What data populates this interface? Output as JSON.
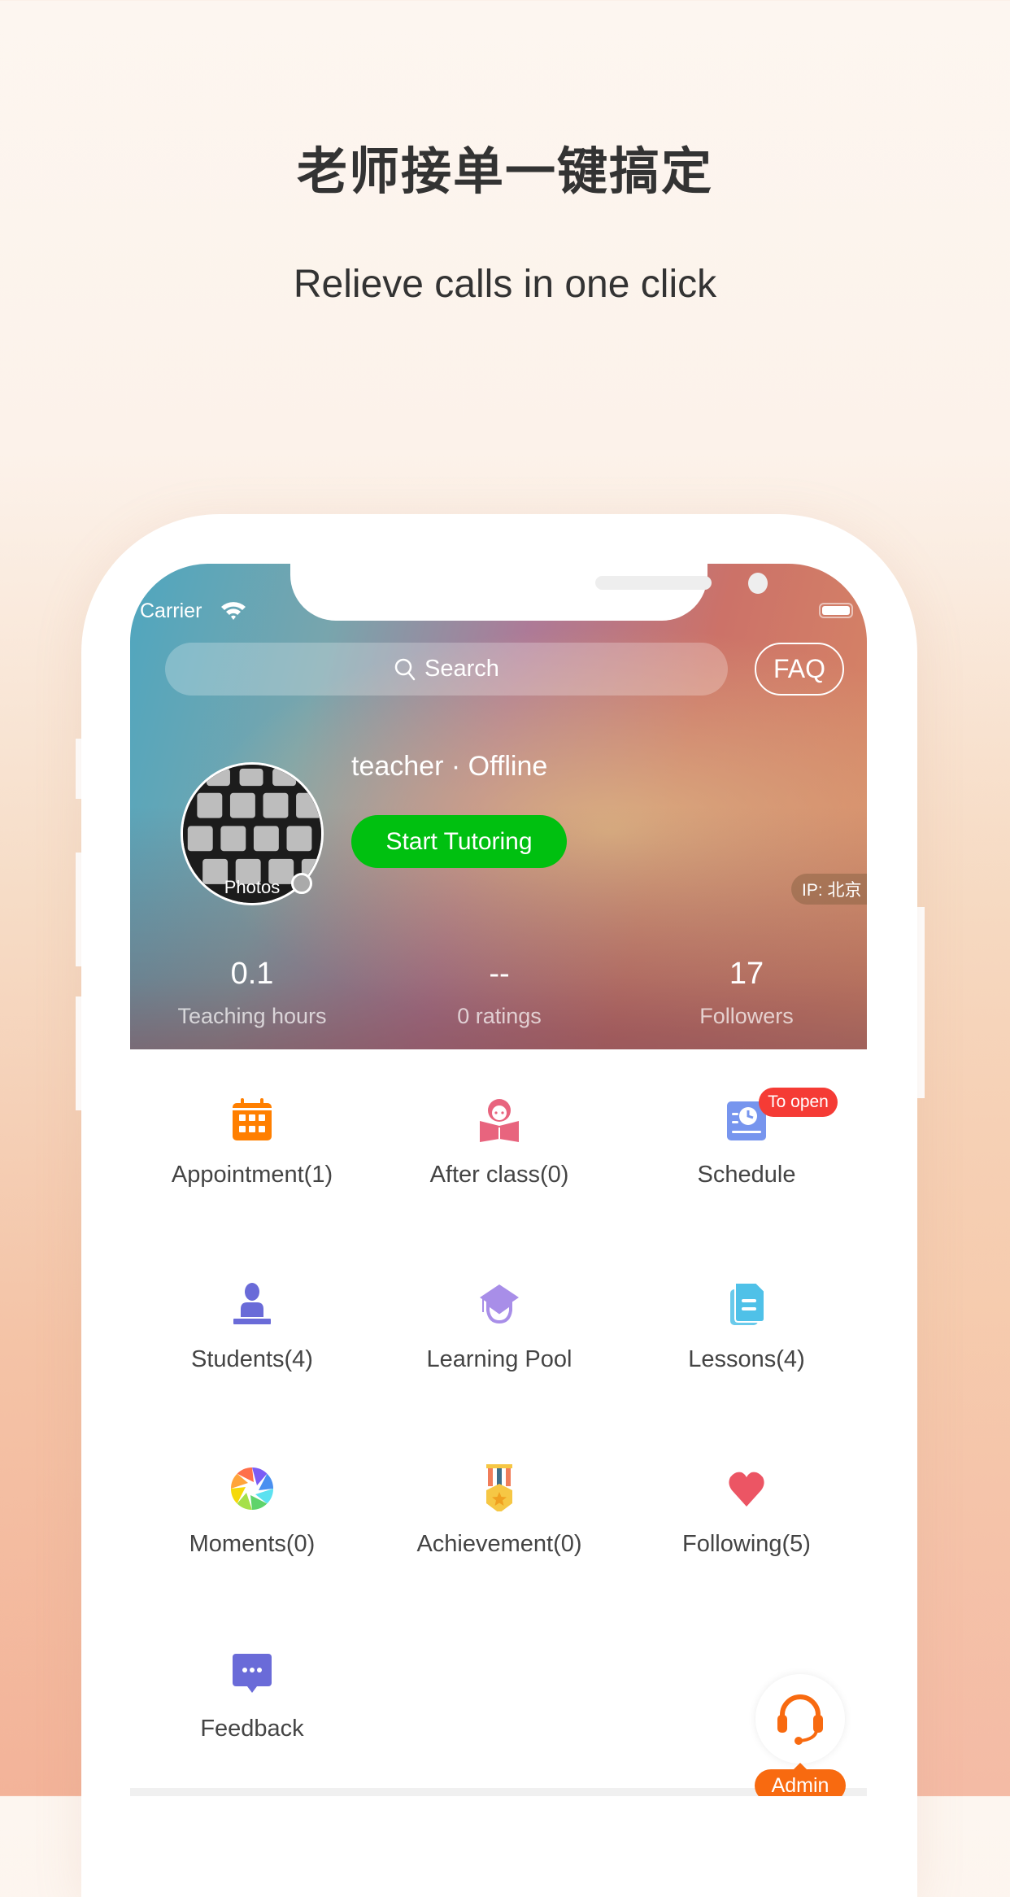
{
  "promo": {
    "title": "老师接单一键搞定",
    "subtitle": "Relieve calls in one click"
  },
  "status_bar": {
    "carrier": "Carrier",
    "wifi_icon": "wifi-icon",
    "battery_icon": "battery-icon"
  },
  "header": {
    "search_placeholder": "Search",
    "search_icon": "search-icon",
    "faq_label": "FAQ",
    "avatar_label": "Photos",
    "name_status": "teacher · Offline",
    "start_button": "Start Tutoring",
    "ip_label": "IP: 北京",
    "stats": [
      {
        "value": "0.1",
        "label": "Teaching hours"
      },
      {
        "value": "--",
        "label": "0 ratings"
      },
      {
        "value": "17",
        "label": "Followers"
      }
    ]
  },
  "menu": {
    "items": [
      {
        "label": "Appointment(1)",
        "icon": "calendar-icon",
        "color": "#ff7f00"
      },
      {
        "label": "After class(0)",
        "icon": "reading-icon",
        "color": "#e8647e"
      },
      {
        "label": "Schedule",
        "icon": "schedule-icon",
        "color": "#7795ee",
        "badge": "To open"
      },
      {
        "label": "Students(4)",
        "icon": "student-icon",
        "color": "#6a6bd8"
      },
      {
        "label": "Learning Pool",
        "icon": "graduation-cap-icon",
        "color": "#a88ee8"
      },
      {
        "label": "Lessons(4)",
        "icon": "document-icon",
        "color": "#4fc1e8"
      },
      {
        "label": "Moments(0)",
        "icon": "aperture-icon",
        "color": "#ff8c42"
      },
      {
        "label": "Achievement(0)",
        "icon": "medal-icon",
        "color": "#f6c744"
      },
      {
        "label": "Following(5)",
        "icon": "heart-icon",
        "color": "#ec5564"
      },
      {
        "label": "Feedback",
        "icon": "feedback-icon",
        "color": "#6a6bd8"
      }
    ]
  },
  "admin": {
    "label": "Admin",
    "icon": "headset-icon",
    "color": "#f86a10"
  },
  "colors": {
    "start_button": "#00c010",
    "badge": "#f53b35"
  }
}
